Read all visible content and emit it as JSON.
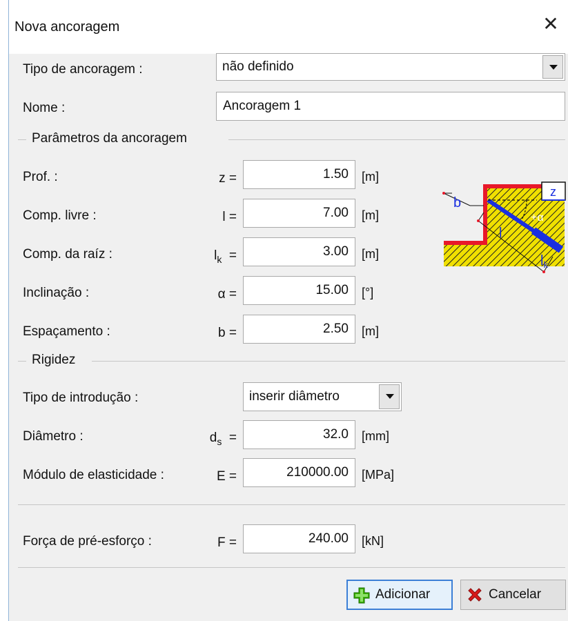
{
  "dialog": {
    "title": "Nova ancoragem",
    "close_symbol": "✕"
  },
  "anchor_type": {
    "label": "Tipo de ancoragem :",
    "value": "não definido"
  },
  "name": {
    "label": "Nome :",
    "value": "Ancoragem 1"
  },
  "params": {
    "heading": "Parâmetros da ancoragem",
    "depth": {
      "label": "Prof. :",
      "symbol": "z  =",
      "value": "1.50",
      "unit": "[m]"
    },
    "free_length": {
      "label": "Comp. livre :",
      "symbol": "l  =",
      "value": "7.00",
      "unit": "[m]"
    },
    "root_length": {
      "label": "Comp. da raíz :",
      "symbol_main": "l",
      "symbol_sub": "k",
      "symbol_eq": "=",
      "value": "3.00",
      "unit": "[m]"
    },
    "inclination": {
      "label": "Inclinação :",
      "symbol": "α  =",
      "value": "15.00",
      "unit": "[°]"
    },
    "spacing": {
      "label": "Espaçamento :",
      "symbol": "b  =",
      "value": "2.50",
      "unit": "[m]"
    }
  },
  "diagram": {
    "label_b": "b",
    "label_z": "z",
    "label_l": "l",
    "label_alpha": "+α",
    "label_lk_main": "l",
    "label_lk_sub": "k"
  },
  "stiffness": {
    "heading": "Rigidez",
    "input_type": {
      "label": "Tipo de introdução :",
      "value": "inserir diâmetro"
    },
    "diameter": {
      "label": "Diâmetro :",
      "symbol_main": "d",
      "symbol_sub": "s",
      "symbol_eq": "=",
      "value": "32.0",
      "unit": "[mm]"
    },
    "modulus": {
      "label": "Módulo de elasticidade :",
      "symbol": "E  =",
      "value": "210000.00",
      "unit": "[MPa]"
    }
  },
  "prestress": {
    "label": "Força de pré-esforço :",
    "symbol": "F  =",
    "value": "240.00",
    "unit": "[kN]"
  },
  "buttons": {
    "add": "Adicionar",
    "cancel": "Cancelar"
  },
  "colors": {
    "accent": "#3c7fd6",
    "hatch": "#f0e000",
    "wall": "#e8182a",
    "anchor": "#1a2fe0"
  }
}
